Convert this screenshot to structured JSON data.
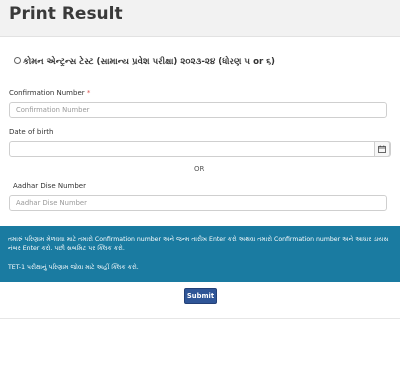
{
  "page": {
    "title": "Print Result"
  },
  "exam": {
    "label": "કોમન એન્ટ્રન્સ ટેસ્ટ (સામાન્ય પ્રવેશ પરીક્ષા) ૨૦૨૩-૨૪ (ધોરણ ૫ or ૬)"
  },
  "form": {
    "confirmation": {
      "label": "Confirmation Number",
      "required_mark": "*",
      "placeholder": "Confirmation Number",
      "value": ""
    },
    "dob": {
      "label": "Date of birth",
      "value": "",
      "icon": "calendar-icon"
    },
    "or_text": "OR",
    "aadhar": {
      "label": "Aadhar Dise Number",
      "placeholder": "Aadhar Dise Number",
      "value": ""
    }
  },
  "info": {
    "line1": "તમારું પરિણામ મેળવવા માટે તમારો Confirmation number અને જન્મ તારીખ Enter કરો અથવા તમારો Confirmation number અને આધાર ડાયસ નંબર Enter કરો. પછી સબમિટ પર ક્લિક કરો.",
    "line2": "TET-1 પરીક્ષાનું પરિણામ જોવા માટે અહીં ક્લિક કરો."
  },
  "submit_label": "Submit",
  "colors": {
    "info_bg": "#1a7ba1",
    "button_bg": "#2f5597",
    "required": "#d9534f"
  }
}
